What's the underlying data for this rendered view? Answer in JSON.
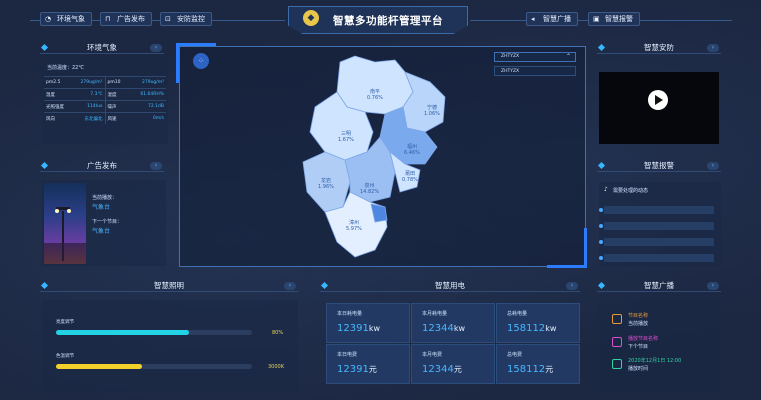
{
  "header": {
    "title": "智慧多功能杆管理平台",
    "left_buttons": [
      {
        "label": "环境气象",
        "icon": "weather-icon"
      },
      {
        "label": "广告发布",
        "icon": "ad-icon"
      },
      {
        "label": "安防监控",
        "icon": "camera-icon"
      }
    ],
    "right_buttons": [
      {
        "label": "智慧广播",
        "icon": "speaker-icon"
      },
      {
        "label": "智慧报警",
        "icon": "alarm-icon"
      }
    ]
  },
  "env": {
    "title": "环境气象",
    "current_temp": "当前温度：22℃",
    "rows": [
      [
        {
          "k": "pm2.5",
          "v": "279ug/m³"
        },
        {
          "k": "pm10",
          "v": "279ug/m³"
        }
      ],
      [
        {
          "k": "温度",
          "v": "7.3℃"
        },
        {
          "k": "湿度",
          "v": "61.64RH%"
        }
      ],
      [
        {
          "k": "光照强度",
          "v": "114lux"
        },
        {
          "k": "噪声",
          "v": "72.1dB"
        }
      ],
      [
        {
          "k": "风向",
          "v": "东北偏北"
        },
        {
          "k": "风速",
          "v": "0m/s"
        }
      ]
    ]
  },
  "ad": {
    "title": "广告发布",
    "current_label": "当前播放：",
    "current_value": "气象台",
    "next_label": "下一个节目：",
    "next_value": "气象台"
  },
  "map": {
    "dropdown_value": "ZHTYZX",
    "dropdown_option": "ZHTYZX",
    "regions": [
      {
        "name": "南平",
        "pct": "0.76%"
      },
      {
        "name": "宁德",
        "pct": "1.06%"
      },
      {
        "name": "三明",
        "pct": "1.67%"
      },
      {
        "name": "福州",
        "pct": "6.46%"
      },
      {
        "name": "龙岩",
        "pct": "1.96%"
      },
      {
        "name": "泉州",
        "pct": "14.82%"
      },
      {
        "name": "莆田",
        "pct": "0.78%"
      },
      {
        "name": "漳州",
        "pct": "5.97%"
      }
    ]
  },
  "security": {
    "title": "智慧安防"
  },
  "alarm": {
    "title": "智慧报警",
    "sub": "需要处理的动态"
  },
  "lighting": {
    "title": "智慧照明",
    "brightness_label": "亮度调节",
    "brightness_value": "80%",
    "brightness_level": 0.68,
    "color_label": "色温调节",
    "color_value": "3000K",
    "color_level": 0.44,
    "colors": {
      "brightness": "#22d3e6",
      "color": "#f2d22a"
    }
  },
  "power": {
    "title": "智慧用电",
    "cells": [
      {
        "label": "本日耗电量",
        "value": "12391",
        "unit": "kw"
      },
      {
        "label": "本月耗电量",
        "value": "12344",
        "unit": "kw"
      },
      {
        "label": "总耗电量",
        "value": "158112",
        "unit": "kw"
      },
      {
        "label": "本日电费",
        "value": "12391",
        "unit": "元"
      },
      {
        "label": "本月电费",
        "value": "12344",
        "unit": "元"
      },
      {
        "label": "总电费",
        "value": "158112",
        "unit": "元"
      }
    ]
  },
  "broadcast": {
    "title": "智慧广播",
    "items": [
      {
        "line1": "节目名称",
        "line2": "当前播放",
        "color": "#e39a3a"
      },
      {
        "line1": "播放节目名称",
        "line2": "下个节目",
        "color": "#d84fd0"
      },
      {
        "line1": "2020年12月1日 12:00",
        "line2": "播放时间",
        "color": "#2fd3a0"
      }
    ]
  }
}
